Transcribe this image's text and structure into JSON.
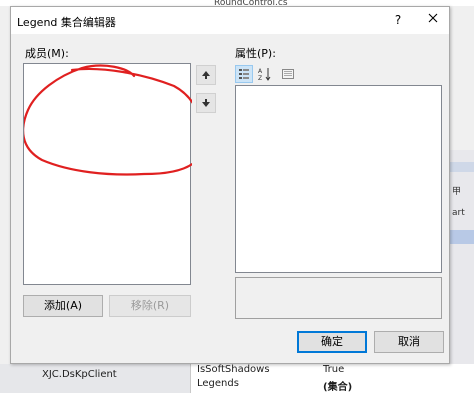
{
  "background": {
    "top_tab_label": "RoundControl.cs",
    "right_label_1": "甲",
    "right_label_2": "art",
    "bottom_left_item": "XJC.DsKpClient",
    "bottom_props": [
      {
        "name": "IsSoftShadows",
        "value": "True"
      },
      {
        "name": "Legends",
        "value": "(集合)"
      }
    ]
  },
  "dialog": {
    "title": "Legend 集合编辑器",
    "help_label": "?",
    "members_label": "成员(M):",
    "properties_label": "属性(P):",
    "add_button": "添加(A)",
    "remove_button": "移除(R)",
    "ok_button": "确定",
    "cancel_button": "取消"
  },
  "icons": [
    "close-icon",
    "arrow-up-icon",
    "arrow-down-icon",
    "categorized-icon",
    "alphabetical-sort-icon",
    "property-pages-icon"
  ],
  "colors": {
    "accent": "#0078d7",
    "scribble": "#e02020",
    "dialog_bg": "#f0f0f0"
  }
}
